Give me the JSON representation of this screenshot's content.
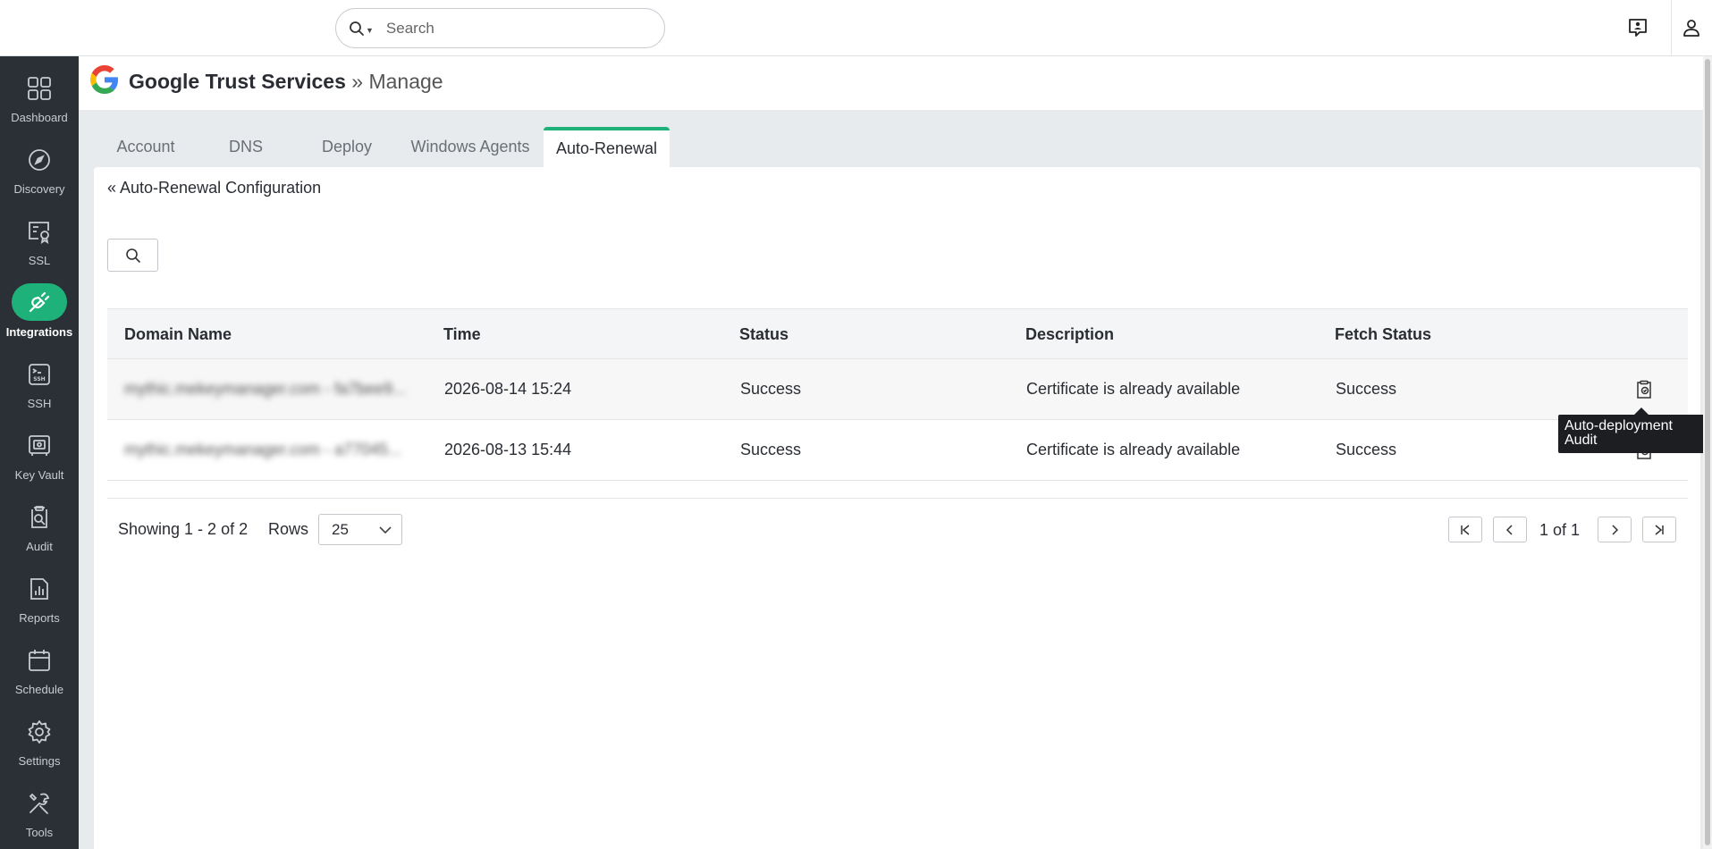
{
  "search": {
    "placeholder": "Search"
  },
  "sidebar": {
    "items": [
      {
        "label": "Dashboard",
        "icon": "dashboard-icon"
      },
      {
        "label": "Discovery",
        "icon": "compass-icon"
      },
      {
        "label": "SSL",
        "icon": "ssl-certificate-icon"
      },
      {
        "label": "Integrations",
        "icon": "plug-icon",
        "active": true
      },
      {
        "label": "SSH",
        "icon": "terminal-icon"
      },
      {
        "label": "Key Vault",
        "icon": "vault-icon"
      },
      {
        "label": "Audit",
        "icon": "audit-icon"
      },
      {
        "label": "Reports",
        "icon": "reports-icon"
      },
      {
        "label": "Schedule",
        "icon": "calendar-icon"
      },
      {
        "label": "Settings",
        "icon": "gear-icon"
      },
      {
        "label": "Tools",
        "icon": "tools-icon"
      }
    ]
  },
  "header": {
    "title": "Google Trust Services",
    "separator": " » ",
    "subtitle": "Manage"
  },
  "tabs": [
    {
      "label": "Account"
    },
    {
      "label": "DNS"
    },
    {
      "label": "Deploy"
    },
    {
      "label": "Windows Agents"
    },
    {
      "label": "Auto-Renewal",
      "active": true
    }
  ],
  "back_link": "« Auto-Renewal Configuration",
  "table": {
    "columns": [
      "Domain Name",
      "Time",
      "Status",
      "Description",
      "Fetch Status"
    ],
    "rows": [
      {
        "domain": "mythic.mekeymanager.com - fa7bee9...",
        "time": "2026-08-14 15:24",
        "status": "Success",
        "description": "Certificate is already available",
        "fetch_status": "Success"
      },
      {
        "domain": "mythic.mekeymanager.com - a77045...",
        "time": "2026-08-13 15:44",
        "status": "Success",
        "description": "Certificate is already available",
        "fetch_status": "Success"
      }
    ]
  },
  "tooltip": {
    "text": "Auto-deployment Audit"
  },
  "footer": {
    "showing": "Showing 1 - 2 of 2",
    "rows_label": "Rows",
    "rows_value": "25",
    "page_text": "1 of 1"
  },
  "colors": {
    "accent": "#1fb17a",
    "sidebar_bg": "#2b2f36",
    "tooltip_bg": "#1c1e22"
  }
}
